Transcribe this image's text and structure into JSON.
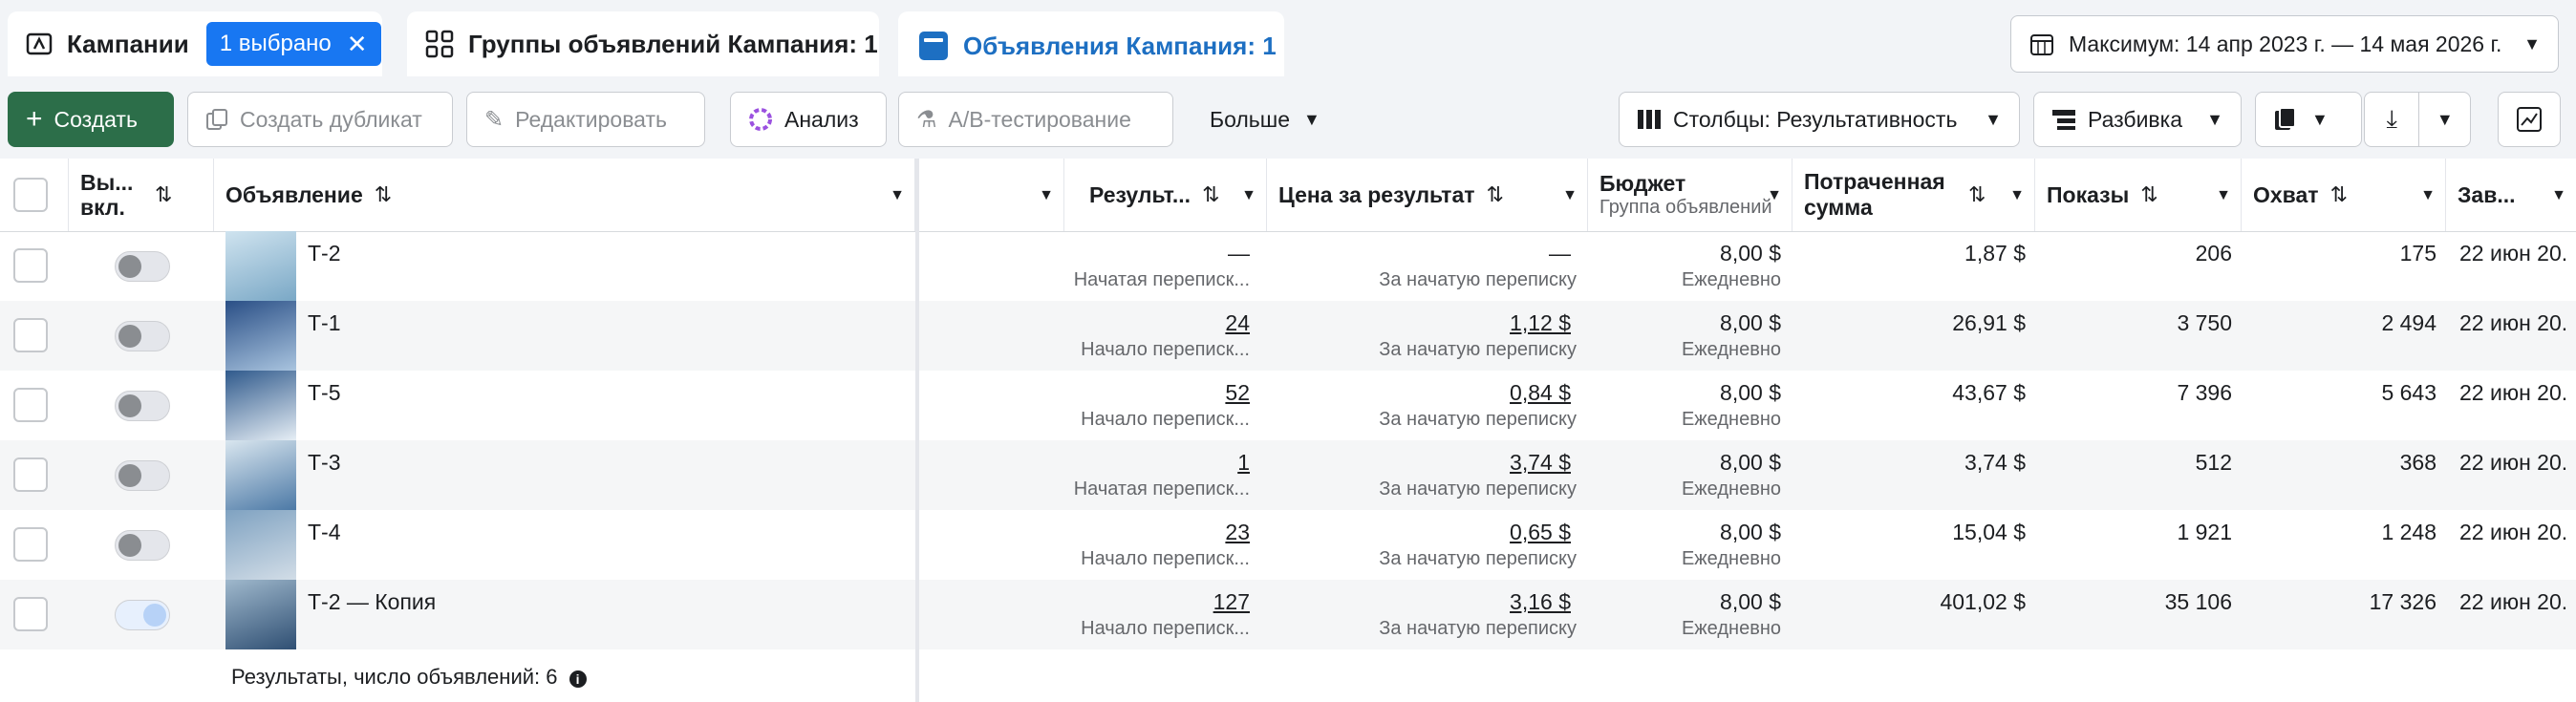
{
  "tabs": {
    "campaigns": "Кампании",
    "selected_badge": "1 выбрано",
    "adsets": "Группы объявлений Кампания: 1",
    "ads": "Объявления Кампания: 1"
  },
  "date_range": "Максимум: 14 апр 2023 г. — 14 мая 2026 г.",
  "toolbar": {
    "create": "Создать",
    "duplicate": "Создать дубликат",
    "edit": "Редактировать",
    "analysis": "Анализ",
    "ab_test": "A/B-тестирование",
    "more": "Больше",
    "columns": "Столбцы: Результативность",
    "breakdown": "Разбивка"
  },
  "columns": {
    "onoff": "Вы... вкл.",
    "ad": "Объявление",
    "results": "Результ...",
    "cost_per_result": "Цена за результат",
    "budget": "Бюджет",
    "budget_sub": "Группа объявлений",
    "spent": "Потраченная сумма",
    "impressions": "Показы",
    "reach": "Охват",
    "ends": "Зав..."
  },
  "rows": [
    {
      "name": "Т-2",
      "on": false,
      "results": "—",
      "results_sub": "Начатая переписк...",
      "cpr": "—",
      "cpr_sub": "За начатую переписку",
      "budget": "8,00 $",
      "budget_sub": "Ежедневно",
      "spent": "1,87 $",
      "impressions": "206",
      "reach": "175",
      "ends": "22 июн 20."
    },
    {
      "name": "Т-1",
      "on": false,
      "results": "24",
      "results_sub": "Начало переписк...",
      "cpr": "1,12 $",
      "cpr_sub": "За начатую переписку",
      "budget": "8,00 $",
      "budget_sub": "Ежедневно",
      "spent": "26,91 $",
      "impressions": "3 750",
      "reach": "2 494",
      "ends": "22 июн 20."
    },
    {
      "name": "Т-5",
      "on": false,
      "results": "52",
      "results_sub": "Начало переписк...",
      "cpr": "0,84 $",
      "cpr_sub": "За начатую переписку",
      "budget": "8,00 $",
      "budget_sub": "Ежедневно",
      "spent": "43,67 $",
      "impressions": "7 396",
      "reach": "5 643",
      "ends": "22 июн 20."
    },
    {
      "name": "Т-3",
      "on": false,
      "results": "1",
      "results_sub": "Начатая переписк...",
      "cpr": "3,74 $",
      "cpr_sub": "За начатую переписку",
      "budget": "8,00 $",
      "budget_sub": "Ежедневно",
      "spent": "3,74 $",
      "impressions": "512",
      "reach": "368",
      "ends": "22 июн 20."
    },
    {
      "name": "Т-4",
      "on": false,
      "results": "23",
      "results_sub": "Начало переписк...",
      "cpr": "0,65 $",
      "cpr_sub": "За начатую переписку",
      "budget": "8,00 $",
      "budget_sub": "Ежедневно",
      "spent": "15,04 $",
      "impressions": "1 921",
      "reach": "1 248",
      "ends": "22 июн 20."
    },
    {
      "name": "Т-2 — Копия",
      "on": true,
      "results": "127",
      "results_sub": "Начало переписк...",
      "cpr": "3,16 $",
      "cpr_sub": "За начатую переписку",
      "budget": "8,00 $",
      "budget_sub": "Ежедневно",
      "spent": "401,02 $",
      "impressions": "35 106",
      "reach": "17 326",
      "ends": "22 июн 20."
    }
  ],
  "footer": "Результаты, число объявлений: 6",
  "colors": {
    "primary_green": "#2c6e49",
    "accent_blue": "#1877f2",
    "active_tab_text": "#1d6fc2"
  }
}
